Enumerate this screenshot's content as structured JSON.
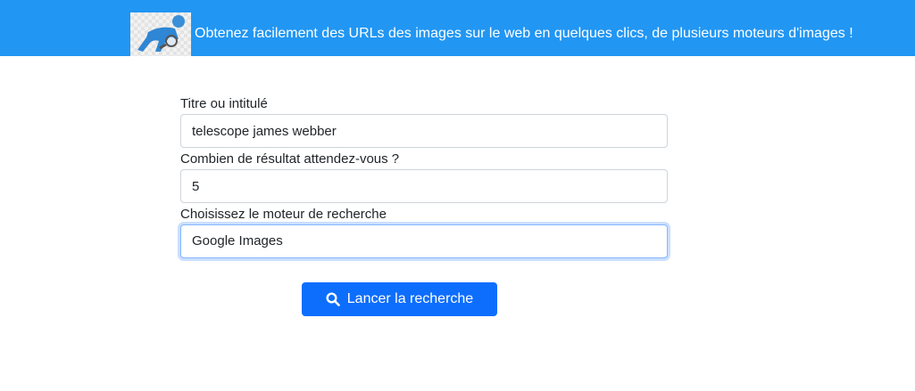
{
  "header": {
    "tagline": "Obtenez facilement des URLs des images sur le web en quelques clics, de plusieurs moteurs d'images !",
    "logo_icon": "person-magnifier-logo"
  },
  "form": {
    "title_label": "Titre ou intitulé",
    "title_value": "telescope james webber",
    "count_label": "Combien de résultat attendez-vous ?",
    "count_value": "5",
    "engine_label": "Choisissez le moteur de recherche",
    "engine_value": "Google Images",
    "submit_label": "Lancer la recherche",
    "submit_icon": "search-icon"
  },
  "colors": {
    "header_bg": "#2196f3",
    "button_bg": "#0d6efd",
    "focus_border": "#86b7fe"
  }
}
